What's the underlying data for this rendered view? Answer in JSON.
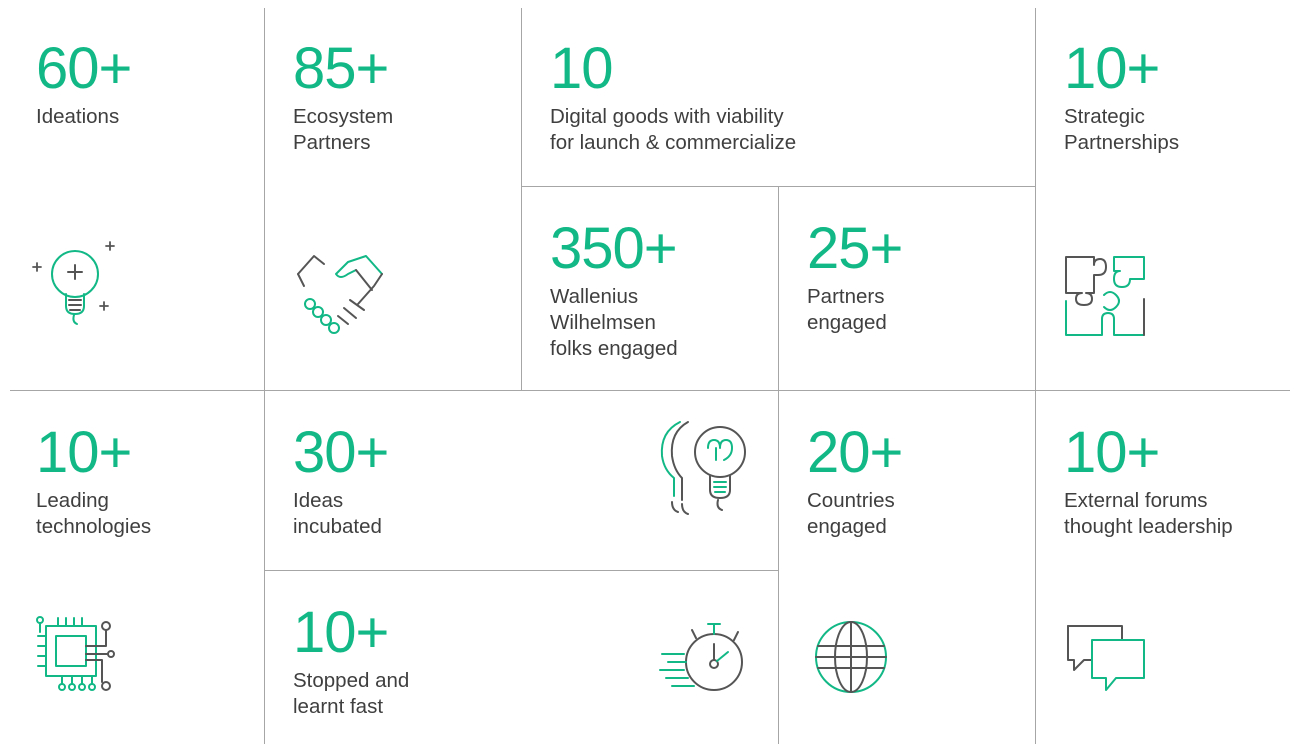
{
  "stats": [
    {
      "value": "60+",
      "label": "Ideations",
      "icon": "lightbulb-plus-icon"
    },
    {
      "value": "85+",
      "label": "Ecosystem\nPartners",
      "icon": "handshake-icon"
    },
    {
      "value": "10",
      "label": "Digital goods with viability\nfor launch & commercialize",
      "icon": ""
    },
    {
      "value": "10+",
      "label": "Strategic\nPartnerships",
      "icon": "puzzle-icon"
    },
    {
      "value": "350+",
      "label": "Wallenius\nWilhelmsen\nfolks engaged",
      "icon": ""
    },
    {
      "value": "25+",
      "label": "Partners\nengaged",
      "icon": ""
    },
    {
      "value": "10+",
      "label": "Leading\ntechnologies",
      "icon": "circuit-chip-icon"
    },
    {
      "value": "30+",
      "label": "Ideas\nincubated",
      "icon": "lightbulbs-stack-icon"
    },
    {
      "value": "20+",
      "label": "Countries\nengaged",
      "icon": "globe-icon"
    },
    {
      "value": "10+",
      "label": "External forums\nthought leadership",
      "icon": "chat-bubbles-icon"
    },
    {
      "value": "10+",
      "label": "Stopped and\nlearnt fast",
      "icon": "stopwatch-speed-icon"
    }
  ],
  "colors": {
    "accent": "#12b886",
    "text": "#3f3f3f",
    "divider": "#a6a6a6",
    "icon_dark": "#555555"
  }
}
